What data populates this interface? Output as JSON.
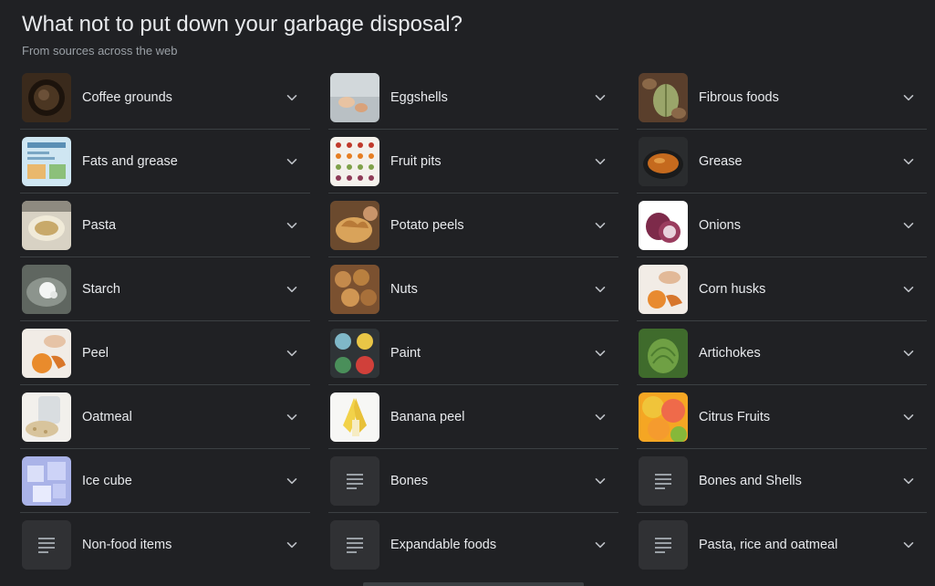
{
  "header": {
    "title": "What not to put down your garbage disposal?",
    "subtitle": "From sources across the web"
  },
  "columns": [
    {
      "items": [
        {
          "label": "Coffee grounds",
          "thumb": "coffee-grounds-photo"
        },
        {
          "label": "Fats and grease",
          "thumb": "fats-and-grease-infographic"
        },
        {
          "label": "Pasta",
          "thumb": "pasta-photo"
        },
        {
          "label": "Starch",
          "thumb": "starch-photo"
        },
        {
          "label": "Peel",
          "thumb": "peel-photo"
        },
        {
          "label": "Oatmeal",
          "thumb": "oatmeal-photo"
        },
        {
          "label": "Ice cube",
          "thumb": "ice-cube-photo"
        },
        {
          "label": "Non-food items",
          "thumb": "article-icon"
        }
      ]
    },
    {
      "items": [
        {
          "label": "Eggshells",
          "thumb": "eggshells-photo"
        },
        {
          "label": "Fruit pits",
          "thumb": "fruit-pits-chart"
        },
        {
          "label": "Potato peels",
          "thumb": "potato-peels-photo"
        },
        {
          "label": "Nuts",
          "thumb": "nuts-photo"
        },
        {
          "label": "Paint",
          "thumb": "paint-photo"
        },
        {
          "label": "Banana peel",
          "thumb": "banana-peel-photo"
        },
        {
          "label": "Bones",
          "thumb": "article-icon"
        },
        {
          "label": "Expandable foods",
          "thumb": "article-icon"
        }
      ]
    },
    {
      "items": [
        {
          "label": "Fibrous foods",
          "thumb": "fibrous-foods-photo"
        },
        {
          "label": "Grease",
          "thumb": "grease-photo"
        },
        {
          "label": "Onions",
          "thumb": "onions-photo"
        },
        {
          "label": "Corn husks",
          "thumb": "corn-husks-photo"
        },
        {
          "label": "Artichokes",
          "thumb": "artichokes-photo"
        },
        {
          "label": "Citrus Fruits",
          "thumb": "citrus-fruits-photo"
        },
        {
          "label": "Bones and Shells",
          "thumb": "article-icon"
        },
        {
          "label": "Pasta, rice and oatmeal",
          "thumb": "article-icon"
        }
      ]
    }
  ],
  "icons": {
    "expand": "chevron-down-icon",
    "placeholder": "article-icon"
  },
  "colors": {
    "background": "#202124",
    "text": "#e8eaed",
    "muted": "#9aa0a6",
    "divider": "#3c4043",
    "chevron": "#bdc1c6"
  }
}
